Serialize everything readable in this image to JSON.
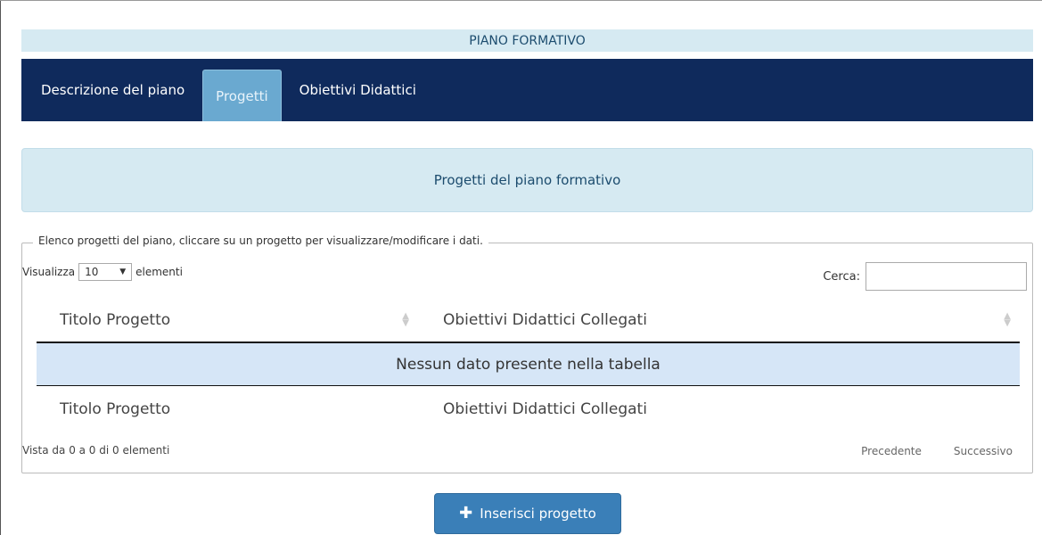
{
  "page": {
    "title": "PIANO FORMATIVO"
  },
  "tabs": [
    {
      "label": "Descrizione del piano",
      "active": false
    },
    {
      "label": "Progetti",
      "active": true
    },
    {
      "label": "Obiettivi Didattici",
      "active": false
    }
  ],
  "section": {
    "header": "Progetti del piano formativo",
    "legend": "Elenco progetti del piano, cliccare su un progetto per visualizzare/modificare i dati."
  },
  "table_controls": {
    "show_label": "Visualizza",
    "show_value": "10",
    "elements_label": "elementi",
    "search_label": "Cerca:",
    "search_value": ""
  },
  "table": {
    "columns": [
      "Titolo Progetto",
      "Obiettivi Didattici Collegati"
    ],
    "empty_message": "Nessun dato presente nella tabella",
    "footer_columns": [
      "Titolo Progetto",
      "Obiettivi Didattici Collegati"
    ]
  },
  "pagination": {
    "info": "Vista da 0 a 0 di 0 elementi",
    "previous": "Precedente",
    "next": "Successivo"
  },
  "actions": {
    "insert_label": "Inserisci progetto"
  },
  "colors": {
    "nav_bg": "#0f2a5c",
    "active_tab": "#6aa9d0",
    "header_bg": "#d6eaf2",
    "button": "#3a7fb8"
  }
}
